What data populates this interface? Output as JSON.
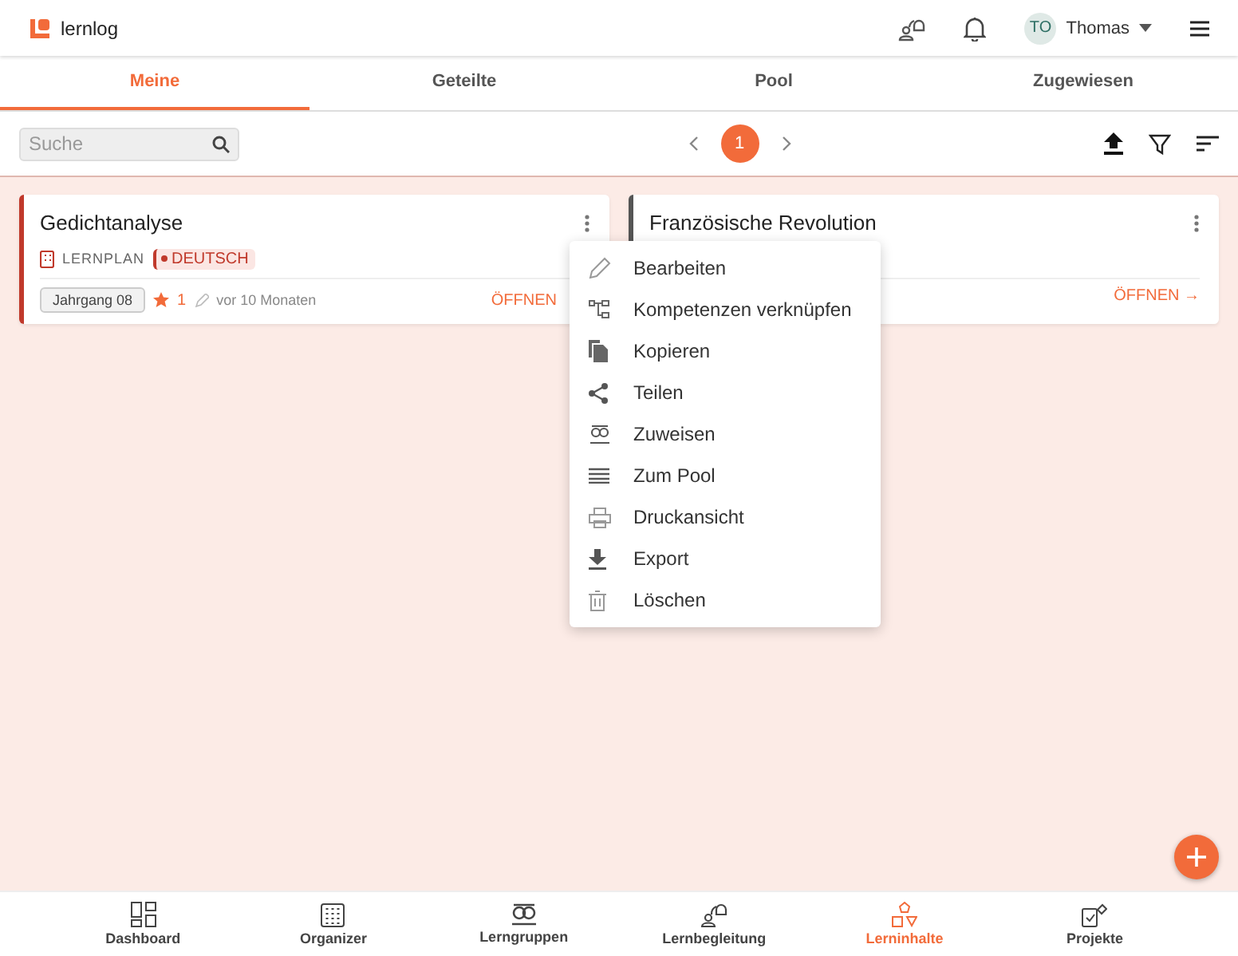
{
  "app": {
    "name": "lernlog"
  },
  "user": {
    "initials": "TO",
    "name": "Thomas"
  },
  "tabs": [
    {
      "label": "Meine",
      "selected": true
    },
    {
      "label": "Geteilte",
      "selected": false
    },
    {
      "label": "Pool",
      "selected": false
    },
    {
      "label": "Zugewiesen",
      "selected": false
    }
  ],
  "search": {
    "placeholder": "Suche"
  },
  "pagination": {
    "pages": [
      {
        "label": "1",
        "selected": true
      }
    ]
  },
  "cards": [
    {
      "title": "Gedichtanalyse",
      "color": "#c0392b",
      "type": "LERNPLAN",
      "subject": "DEUTSCH",
      "grade": "Jahrgang 08",
      "stars_count": "1",
      "updated": "vor 10 Monaten",
      "open_label": "ÖFFNEN"
    },
    {
      "title": "Französische Revolution",
      "color": "#555555",
      "open_label": "ÖFFNEN",
      "arrow": "→"
    }
  ],
  "menu": [
    {
      "kind": "pencil",
      "label": "Bearbeiten"
    },
    {
      "kind": "link",
      "label": "Kompetenzen verknüpfen"
    },
    {
      "kind": "copy",
      "label": "Kopieren"
    },
    {
      "kind": "share",
      "label": "Teilen"
    },
    {
      "kind": "assign",
      "label": "Zuweisen"
    },
    {
      "kind": "list",
      "label": "Zum Pool"
    },
    {
      "kind": "print",
      "label": "Druckansicht"
    },
    {
      "kind": "download",
      "label": "Export"
    },
    {
      "kind": "trash",
      "label": "Löschen"
    }
  ],
  "bottom_nav": [
    {
      "kind": "dashboard",
      "label": "Dashboard",
      "selected": false
    },
    {
      "kind": "calendar",
      "label": "Organizer",
      "selected": false
    },
    {
      "kind": "group",
      "label": "Lerngruppen",
      "selected": false
    },
    {
      "kind": "mentor",
      "label": "Lernbegleitung",
      "selected": false
    },
    {
      "kind": "shapes",
      "label": "Lerninhalte",
      "selected": true
    },
    {
      "kind": "project",
      "label": "Projekte",
      "selected": false
    }
  ]
}
